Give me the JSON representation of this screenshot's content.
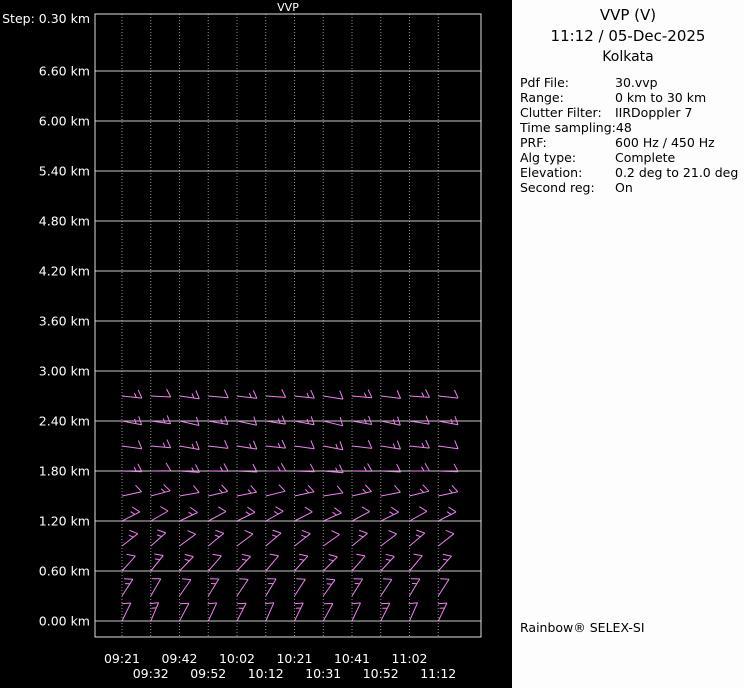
{
  "colors": {
    "bg": "#000000",
    "panel_bg": "#fdfdfd",
    "axis": "#e0e0e0",
    "grid_solid": "#c9c9c9",
    "grid_dotted": "#8f8f8f",
    "text": "#ffffff",
    "panel_text": "#000000",
    "barb": "#ee82ee"
  },
  "chart_data": {
    "type": "wind-barb-time-height-profile",
    "title": "VVP",
    "step_label": "Step: 0.30 km",
    "x_ticks": [
      "09:21",
      "09:32",
      "09:42",
      "09:52",
      "10:02",
      "10:12",
      "10:21",
      "10:31",
      "10:41",
      "10:52",
      "11:02",
      "11:12"
    ],
    "y_ticks": [
      "6.60 km",
      "6.00 km",
      "5.40 km",
      "4.80 km",
      "4.20 km",
      "3.60 km",
      "3.00 km",
      "2.40 km",
      "1.80 km",
      "1.20 km",
      "0.60 km",
      "0.00 km"
    ],
    "y_step_km": 0.3,
    "y_range_km": [
      0.0,
      7.2
    ],
    "grid": "dotted-vertical-solid-horizontal",
    "barb_units": "knots",
    "barb_rows": [
      {
        "h": 2.7,
        "dir": [
          96,
          93,
          98,
          95,
          97,
          94,
          96,
          99,
          95,
          97,
          94,
          96
        ],
        "spd": [
          15,
          10,
          15,
          10,
          15,
          10,
          15,
          10,
          15,
          10,
          15,
          10
        ]
      },
      {
        "h": 2.4,
        "dir": [
          101,
          98,
          103,
          100,
          102,
          99,
          101,
          104,
          100,
          102,
          99,
          101
        ],
        "spd": [
          15,
          15,
          10,
          15,
          10,
          15,
          15,
          10,
          15,
          15,
          10,
          15
        ]
      },
      {
        "h": 2.1,
        "dir": [
          98,
          95,
          100,
          97,
          99,
          96,
          98,
          101,
          97,
          99,
          96,
          98
        ],
        "spd": [
          10,
          15,
          15,
          10,
          15,
          15,
          10,
          15,
          10,
          15,
          15,
          10
        ]
      },
      {
        "h": 1.8,
        "dir": [
          92,
          89,
          94,
          91,
          93,
          90,
          92,
          95,
          91,
          93,
          90,
          92
        ],
        "spd": [
          15,
          10,
          15,
          15,
          10,
          15,
          10,
          15,
          15,
          10,
          15,
          10
        ]
      },
      {
        "h": 1.5,
        "dir": [
          78,
          75,
          80,
          77,
          79,
          76,
          78,
          81,
          77,
          79,
          76,
          78
        ],
        "spd": [
          10,
          15,
          10,
          15,
          15,
          10,
          15,
          10,
          15,
          10,
          15,
          15
        ]
      },
      {
        "h": 1.2,
        "dir": [
          63,
          60,
          65,
          62,
          64,
          61,
          63,
          66,
          62,
          64,
          61,
          63
        ],
        "spd": [
          15,
          10,
          15,
          10,
          15,
          15,
          10,
          15,
          10,
          15,
          10,
          15
        ]
      },
      {
        "h": 0.9,
        "dir": [
          52,
          49,
          54,
          51,
          53,
          50,
          52,
          55,
          51,
          53,
          50,
          52
        ],
        "spd": [
          15,
          15,
          10,
          15,
          10,
          15,
          15,
          10,
          15,
          10,
          15,
          10
        ]
      },
      {
        "h": 0.6,
        "dir": [
          42,
          39,
          44,
          41,
          43,
          40,
          42,
          45,
          41,
          43,
          40,
          42
        ],
        "spd": [
          10,
          15,
          15,
          10,
          15,
          10,
          15,
          15,
          10,
          15,
          10,
          15
        ]
      },
      {
        "h": 0.3,
        "dir": [
          33,
          30,
          35,
          32,
          34,
          31,
          33,
          36,
          32,
          34,
          31,
          33
        ],
        "spd": [
          15,
          10,
          10,
          15,
          10,
          15,
          10,
          15,
          15,
          10,
          15,
          10
        ]
      },
      {
        "h": 0.0,
        "dir": [
          26,
          23,
          28,
          25,
          27,
          24,
          26,
          29,
          25,
          27,
          24,
          26
        ],
        "spd": [
          10,
          15,
          10,
          10,
          15,
          10,
          15,
          10,
          10,
          15,
          10,
          15
        ]
      }
    ]
  },
  "panel": {
    "title": "VVP (V)",
    "datetime": "11:12 / 05-Dec-2025",
    "site": "Kolkata",
    "rows": [
      {
        "label": "Pdf File:",
        "value": "30.vvp"
      },
      {
        "label": "Range:",
        "value": "0 km to 30 km"
      },
      {
        "label": "Clutter Filter:",
        "value": "IIRDoppler 7"
      },
      {
        "label": "Time sampling:",
        "value": "48"
      },
      {
        "label": "PRF:",
        "value": "600 Hz / 450 Hz"
      },
      {
        "label": "Alg type:",
        "value": "Complete"
      },
      {
        "label": "Elevation:",
        "value": "0.2 deg to 21.0 deg"
      },
      {
        "label": "Second reg:",
        "value": "On"
      }
    ],
    "footer": "Rainbow® SELEX-SI"
  }
}
